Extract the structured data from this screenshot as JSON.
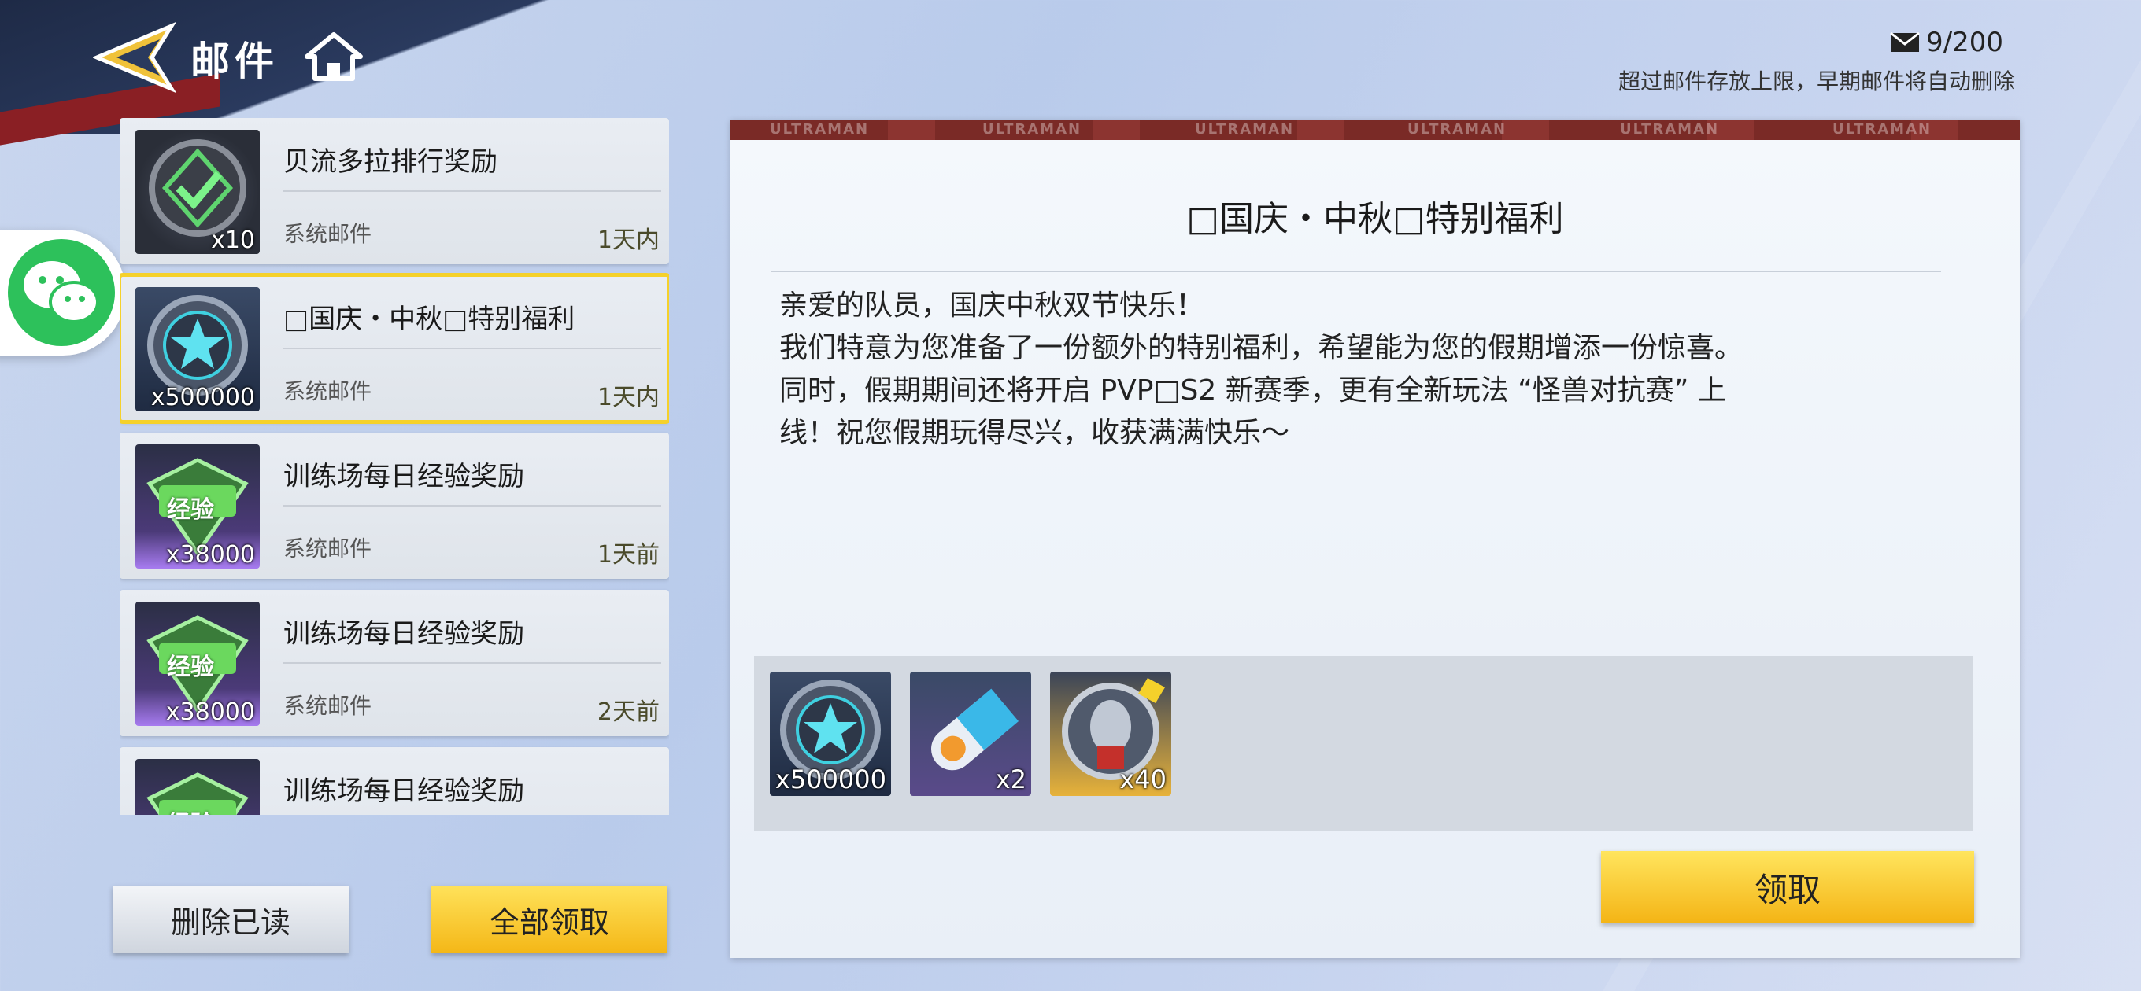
{
  "header": {
    "title": "邮件",
    "mail_count": "9/200",
    "notice": "超过邮件存放上限，早期邮件将自动删除"
  },
  "mail_list": [
    {
      "subject": "贝流多拉排行奖励",
      "sender": "系统邮件",
      "time": "1天内",
      "thumb_qty": "x10",
      "icon": "check-badge-icon"
    },
    {
      "subject": "□国庆・中秋□特别福利",
      "sender": "系统邮件",
      "time": "1天内",
      "thumb_qty": "x500000",
      "icon": "star-coin-icon"
    },
    {
      "subject": "训练场每日经验奖励",
      "sender": "系统邮件",
      "time": "1天前",
      "thumb_qty": "x38000",
      "icon": "exp-badge-icon",
      "badge": "经验"
    },
    {
      "subject": "训练场每日经验奖励",
      "sender": "系统邮件",
      "time": "2天前",
      "thumb_qty": "x38000",
      "icon": "exp-badge-icon",
      "badge": "经验"
    },
    {
      "subject": "训练场每日经验奖励",
      "sender": "",
      "time": "",
      "thumb_qty": "",
      "icon": "exp-badge-icon",
      "badge": "经验"
    }
  ],
  "buttons": {
    "delete_read": "删除已读",
    "collect_all": "全部领取",
    "claim": "领取"
  },
  "detail": {
    "band_text": "ULTRAMAN",
    "title": "□国庆・中秋□特别福利",
    "body_lines": [
      "亲爱的队员，国庆中秋双节快乐！",
      "我们特意为您准备了一份额外的特别福利，希望能为您的假期增添一份惊喜。",
      "同时，假期期间还将开启 PVP□S2 新赛季，更有全新玩法 “怪兽对抗赛” 上",
      "线！祝您假期玩得尽兴，收获满满快乐～"
    ],
    "rewards": [
      {
        "name": "star-coin-icon",
        "qty": "x500000"
      },
      {
        "name": "capsule-icon",
        "qty": "x2"
      },
      {
        "name": "ultraman-medal-icon",
        "qty": "x40"
      }
    ]
  },
  "colors": {
    "accent_yellow": "#f5d12b",
    "wechat_green": "#2dc15b",
    "header_dark": "#1e2a46",
    "header_red": "#8a1f24"
  }
}
